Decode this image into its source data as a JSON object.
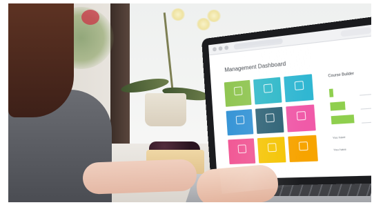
{
  "dashboard": {
    "title": "Management Dashboard",
    "tiles": [
      {
        "label": "",
        "color": "#8bc34a"
      },
      {
        "label": "",
        "color": "#2bb7c8"
      },
      {
        "label": "",
        "color": "#30b7d2"
      },
      {
        "label": "",
        "color": "#2c8fd4"
      },
      {
        "label": "",
        "color": "#2a5f73"
      },
      {
        "label": "",
        "color": "#f05aa8"
      },
      {
        "label": "",
        "color": "#f04e8f"
      },
      {
        "label": "",
        "color": "#f5c400"
      },
      {
        "label": "",
        "color": "#f7a400"
      }
    ],
    "side_panel": {
      "title": "Course Builder",
      "subtitle": "",
      "metrics": [
        {
          "value": "4",
          "caption": "",
          "level": 0.15,
          "color": "#8fcf4e"
        },
        {
          "value": "127",
          "caption": "",
          "level": 0.55,
          "color": "#8fcf4e"
        },
        {
          "value": "62",
          "caption": "",
          "level": 0.85,
          "color": "#8fcf4e"
        }
      ],
      "notes": [
        {
          "pre": "You have",
          "strong": "",
          "post": ""
        },
        {
          "pre": "You have",
          "strong": "",
          "post": ""
        }
      ]
    }
  }
}
